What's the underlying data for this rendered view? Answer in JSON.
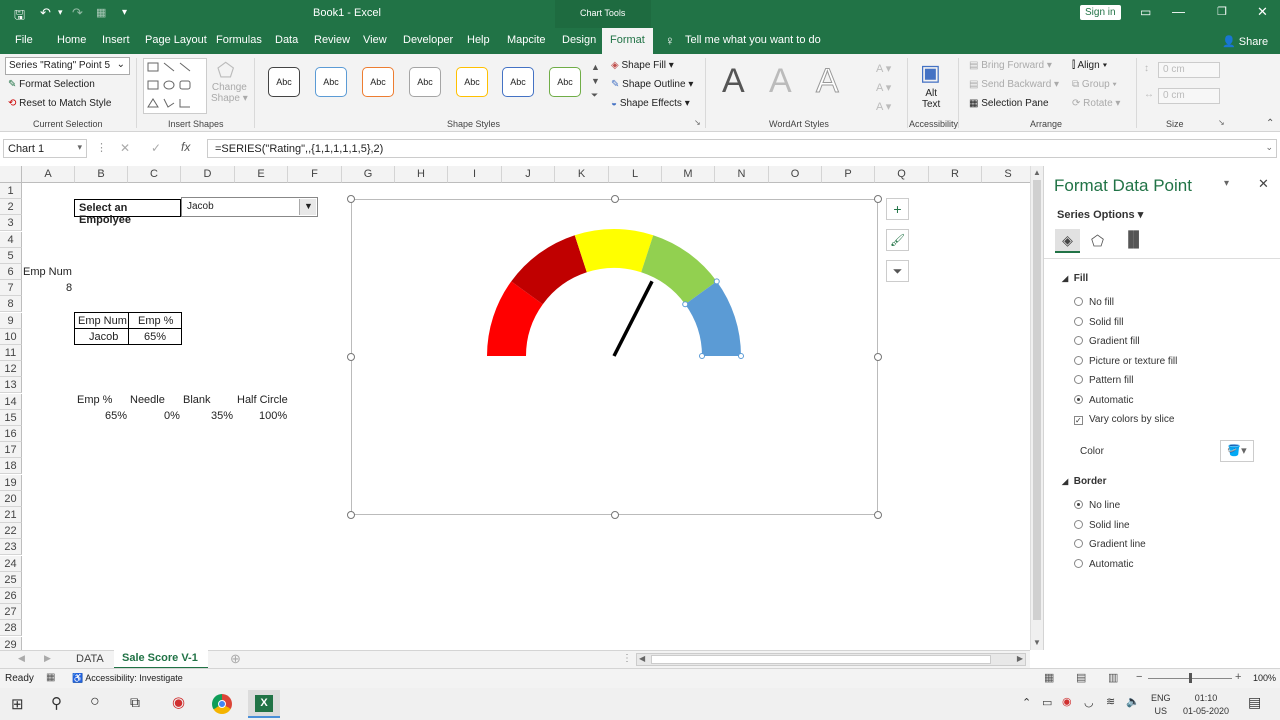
{
  "titlebar": {
    "quick_access_dropdown": "▾",
    "file_name": "Book1",
    "app_sep": " - ",
    "app_name": "Excel",
    "context_title": "Chart Tools",
    "signin": "Sign in"
  },
  "tabs": [
    "File",
    "Home",
    "Insert",
    "Page Layout",
    "Formulas",
    "Data",
    "Review",
    "View",
    "Developer",
    "Help",
    "Mapcite",
    "Design",
    "Format"
  ],
  "tell_me": "Tell me what you want to do",
  "share": "Share",
  "ribbon": {
    "current_selection": {
      "dropdown": "Series \"Rating\" Point 5",
      "format_selection": "Format Selection",
      "reset": "Reset to Match Style",
      "label": "Current Selection"
    },
    "insert_shapes": {
      "change_shape_1": "Change",
      "change_shape_2": "Shape",
      "label": "Insert Shapes"
    },
    "shape_styles": {
      "abc": "Abc",
      "fill": "Shape Fill",
      "outline": "Shape Outline",
      "effects": "Shape Effects",
      "label": "Shape Styles",
      "style_colors": [
        "#444444",
        "#5b9bd5",
        "#ed7d31",
        "#a5a5a5",
        "#ffc000",
        "#4472c4",
        "#70ad47"
      ]
    },
    "wordart": {
      "letter": "A",
      "label": "WordArt Styles"
    },
    "accessibility": {
      "alt1": "Alt",
      "alt2": "Text",
      "label": "Accessibility"
    },
    "arrange": {
      "bring_forward": "Bring Forward",
      "send_backward": "Send Backward",
      "selection_pane": "Selection Pane",
      "align": "Align",
      "group": "Group",
      "rotate": "Rotate",
      "label": "Arrange"
    },
    "size": {
      "height": "0 cm",
      "width": "0 cm",
      "label": "Size"
    }
  },
  "formula_bar": {
    "name_box": "Chart 1",
    "fx": "fx",
    "formula": "=SERIES(\"Rating\",,{1,1,1,1,1,5},2)"
  },
  "columns": [
    "A",
    "B",
    "C",
    "D",
    "E",
    "F",
    "G",
    "H",
    "I",
    "J",
    "K",
    "L",
    "M",
    "N",
    "O",
    "P",
    "Q",
    "R",
    "S"
  ],
  "rows": [
    "1",
    "2",
    "3",
    "4",
    "5",
    "6",
    "7",
    "8",
    "9",
    "10",
    "11",
    "12",
    "13",
    "14",
    "15",
    "16",
    "17",
    "18",
    "19",
    "20",
    "21",
    "22",
    "23",
    "24",
    "25",
    "26",
    "27",
    "28",
    "29"
  ],
  "sheet": {
    "select_label": "Select an Empolyee",
    "select_value": "Jacob",
    "emp_num_label": "Emp Num",
    "emp_num_value": "8",
    "table_head": [
      "Emp Num",
      "Emp %"
    ],
    "table_row": [
      "Jacob",
      "65%"
    ],
    "calc_head": [
      "Emp %",
      "Needle",
      "Blank",
      "Half Circle"
    ],
    "calc_row": [
      "65%",
      "0%",
      "35%",
      "100%"
    ]
  },
  "gauge": {
    "segments": [
      {
        "color": "#ff0000"
      },
      {
        "color": "#c00000"
      },
      {
        "color": "#ffff00"
      },
      {
        "color": "#92d050"
      },
      {
        "color": "#5b9bd5"
      }
    ],
    "needle_value": 0.65
  },
  "pane": {
    "title": "Format Data Point",
    "series_options": "Series Options",
    "fill_header": "Fill",
    "fill_options": [
      "No fill",
      "Solid fill",
      "Gradient fill",
      "Picture or texture fill",
      "Pattern fill",
      "Automatic"
    ],
    "fill_selected": 5,
    "vary_colors": "Vary colors by slice",
    "color_label": "Color",
    "border_header": "Border",
    "border_options": [
      "No line",
      "Solid line",
      "Gradient line",
      "Automatic"
    ],
    "border_selected": 0
  },
  "sheet_tabs": [
    "DATA",
    "Sale Score V-1"
  ],
  "status": {
    "ready": "Ready",
    "accessibility": "Accessibility: Investigate",
    "zoom": "100%"
  },
  "taskbar": {
    "lang": "ENG",
    "region": "US",
    "time": "01:10",
    "date": "01-05-2020"
  }
}
